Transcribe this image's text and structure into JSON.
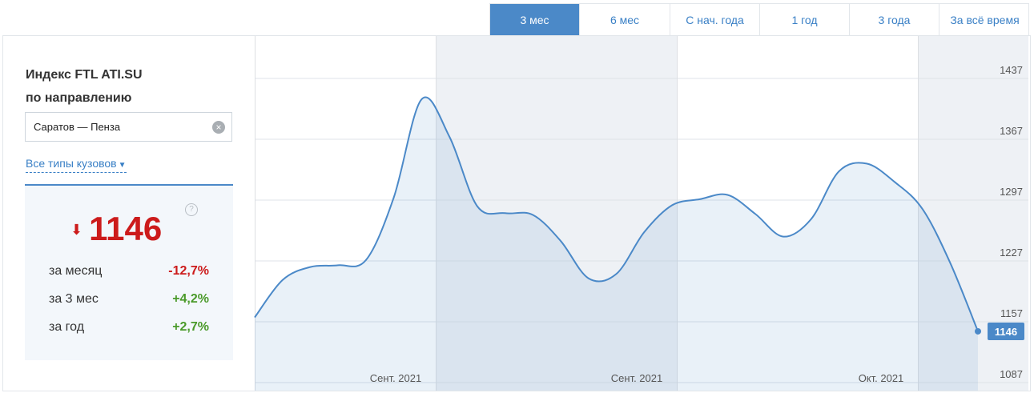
{
  "tabs": [
    "3 мес",
    "6 мес",
    "С нач. года",
    "1 год",
    "3 года",
    "За всё время"
  ],
  "active_tab": 0,
  "panel": {
    "title_line1": "Индекс FTL ATI.SU",
    "title_line2": "по направлению",
    "route_value": "Саратов — Пенза",
    "body_types_label": "Все типы кузовов",
    "index_value": "1146",
    "help_symbol": "?",
    "stats": [
      {
        "label": "за месяц",
        "value": "-12,7%",
        "trend": "down"
      },
      {
        "label": "за 3 мес",
        "value": "+4,2%",
        "trend": "up"
      },
      {
        "label": "за год",
        "value": "+2,7%",
        "trend": "up"
      }
    ]
  },
  "colors": {
    "accent": "#4b89c8",
    "negative": "#cc1b1b",
    "positive": "#4a9a2a"
  },
  "icons": {
    "clear": "clear-icon",
    "chevron": "chevron-down-icon",
    "trend": "arrow-down-icon",
    "help": "question-icon"
  },
  "chart_data": {
    "type": "area",
    "x_labels": [
      "Сент. 2021",
      "Сент. 2021",
      "Окт. 2021"
    ],
    "y_ticks": [
      1087,
      1157,
      1227,
      1297,
      1367,
      1437
    ],
    "ylim": [
      1087,
      1437
    ],
    "last_value_label": "1146",
    "series": [
      {
        "values": [
          1162,
          1205,
          1220,
          1222,
          1228,
          1300,
          1413,
          1370,
          1290,
          1282,
          1280,
          1250,
          1207,
          1212,
          1260,
          1291,
          1298,
          1303,
          1281,
          1255,
          1275,
          1330,
          1339,
          1318,
          1287,
          1225,
          1146
        ]
      }
    ]
  }
}
